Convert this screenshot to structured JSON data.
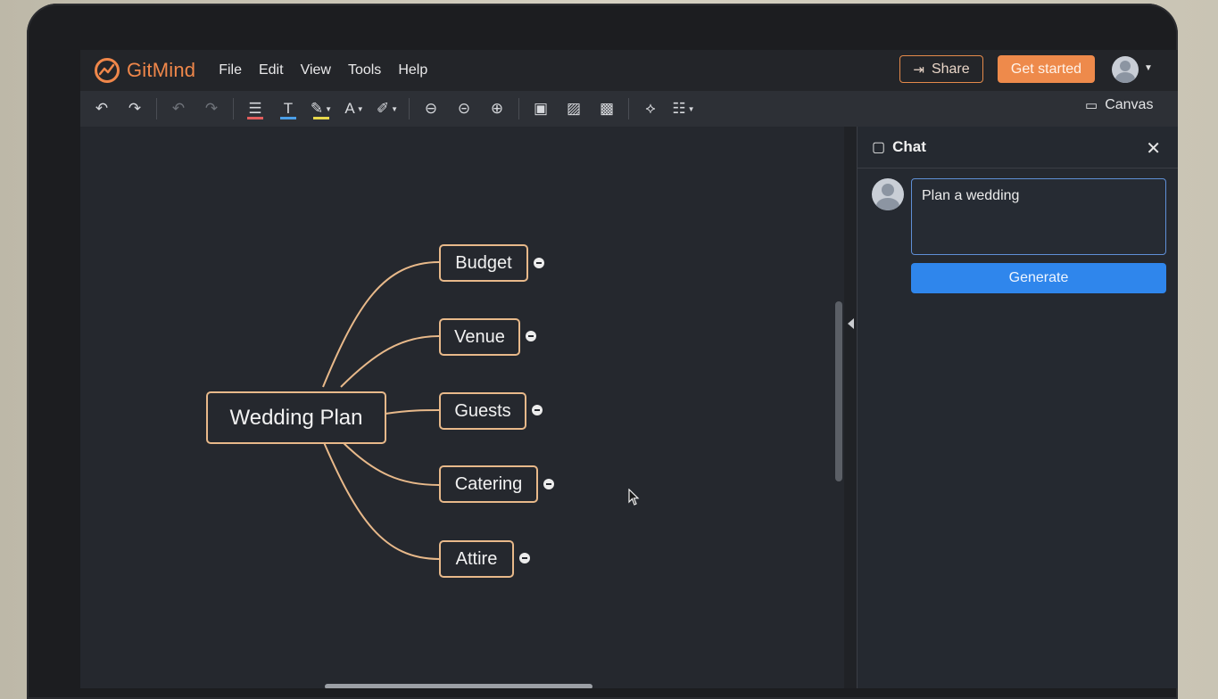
{
  "app": {
    "name": "GitMind",
    "brand_color": "#f0874a"
  },
  "menu": {
    "items": [
      "File",
      "Edit",
      "View",
      "Tools",
      "Help"
    ]
  },
  "header": {
    "share_label": "Share",
    "get_started_label": "Get started"
  },
  "toolbar": {
    "canvas_label": "Canvas",
    "icons": [
      "undo-icon",
      "redo-icon",
      "undo-disabled-icon",
      "redo-disabled-icon",
      "align-icon",
      "text-color-icon",
      "highlight-icon",
      "font-icon",
      "brush-icon",
      "zoom-out-icon",
      "zoom-fit-icon",
      "zoom-in-icon",
      "folder-icon",
      "image-icon",
      "ai-image-icon",
      "layout-icon",
      "outline-icon"
    ]
  },
  "mindmap": {
    "root": "Wedding Plan",
    "branches": [
      "Budget",
      "Venue",
      "Guests",
      "Catering",
      "Attire"
    ],
    "line_color": "#e8b98a"
  },
  "chat": {
    "title": "Chat",
    "prompt_value": "Plan a wedding",
    "generate_label": "Generate",
    "accent": "#2f86ec"
  }
}
